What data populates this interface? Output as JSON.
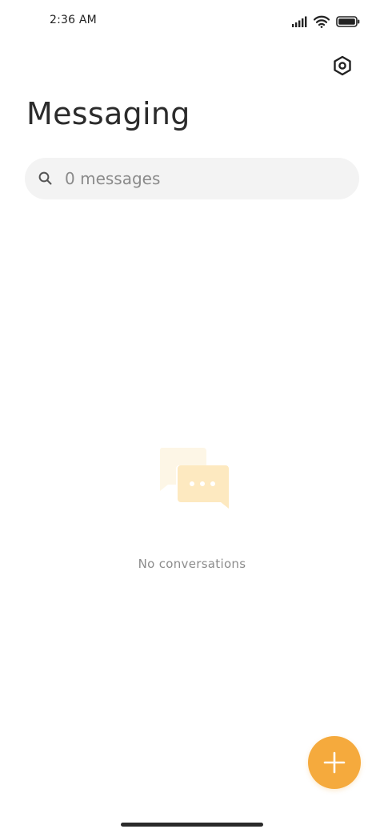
{
  "status_bar": {
    "time": "2:36 AM",
    "icons": [
      "cellular-signal-icon",
      "wifi-icon",
      "battery-icon"
    ]
  },
  "header": {
    "title": "Messaging",
    "settings_icon": "gear-icon"
  },
  "search": {
    "placeholder": "0 messages",
    "icon": "search-icon"
  },
  "empty_state": {
    "illustration": "chat-bubbles-icon",
    "message": "No conversations"
  },
  "fab": {
    "icon": "plus-icon"
  },
  "colors": {
    "accent": "#f5aa3d",
    "illustration_back": "#fdf6e6",
    "illustration_front": "#fde9c0",
    "search_bg": "#f3f3f3",
    "muted_text": "#8c8c8c"
  }
}
